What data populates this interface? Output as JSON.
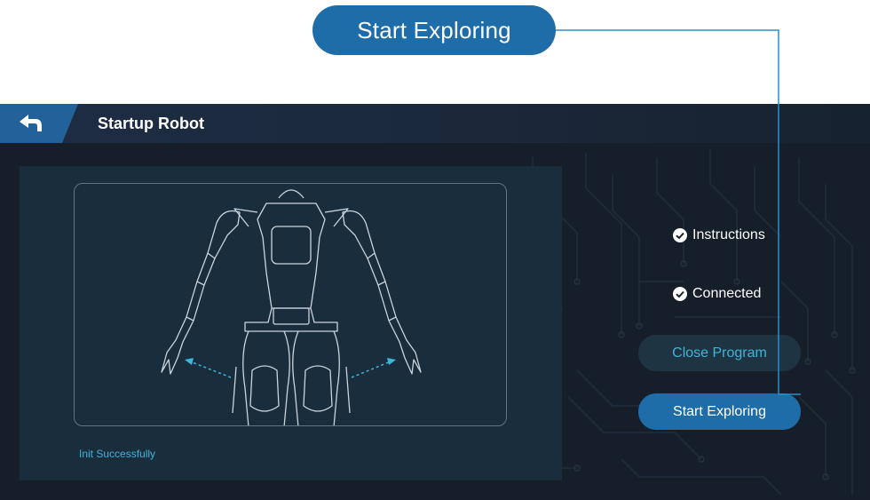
{
  "callout": {
    "label": "Start Exploring"
  },
  "header": {
    "title": "Startup Robot",
    "back_icon": "back-arrow-icon"
  },
  "viewport": {
    "status": "Init Successfully"
  },
  "checklist": [
    {
      "label": "Instructions",
      "icon": "check-circle-icon"
    },
    {
      "label": "Connected",
      "icon": "check-circle-icon"
    }
  ],
  "buttons": {
    "close": "Close Program",
    "start": "Start Exploring"
  },
  "colors": {
    "accent": "#1f6da8",
    "status_text": "#3fb6d8",
    "background": "#151e29",
    "viewport": "#1a2d3d"
  }
}
